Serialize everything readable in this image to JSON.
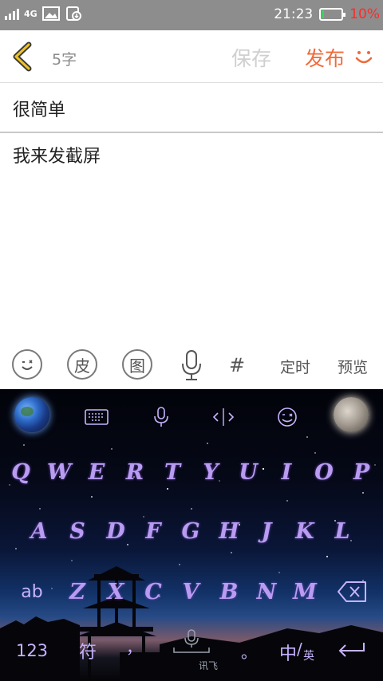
{
  "status_bar": {
    "network": "4G",
    "time": "21:23",
    "battery": "10%"
  },
  "header": {
    "char_count": "5字",
    "save_label": "保存",
    "publish_label": "发布"
  },
  "post": {
    "title": "很简单",
    "body": "我来发截屏"
  },
  "editor_toolbar": {
    "skin_label": "皮",
    "image_label": "图",
    "hashtag_label": "#",
    "schedule_label": "定时",
    "preview_label": "预览"
  },
  "keyboard": {
    "row1": [
      "Q",
      "W",
      "E",
      "R",
      "T",
      "Y",
      "U",
      "I",
      "O",
      "P"
    ],
    "row2": [
      "A",
      "S",
      "D",
      "F",
      "G",
      "H",
      "J",
      "K",
      "L"
    ],
    "row3": [
      "Z",
      "X",
      "C",
      "V",
      "B",
      "N",
      "M"
    ],
    "shift_label": "ab",
    "numbers_label": "123",
    "symbols_label": "符",
    "comma_label": "，",
    "space_label": "讯飞",
    "period_label": "。",
    "lang_main": "中",
    "lang_sub": "英"
  },
  "colors": {
    "accent": "#ef6a3a",
    "key_text": "#b99cf2",
    "status_bar": "#8d8d8d"
  }
}
